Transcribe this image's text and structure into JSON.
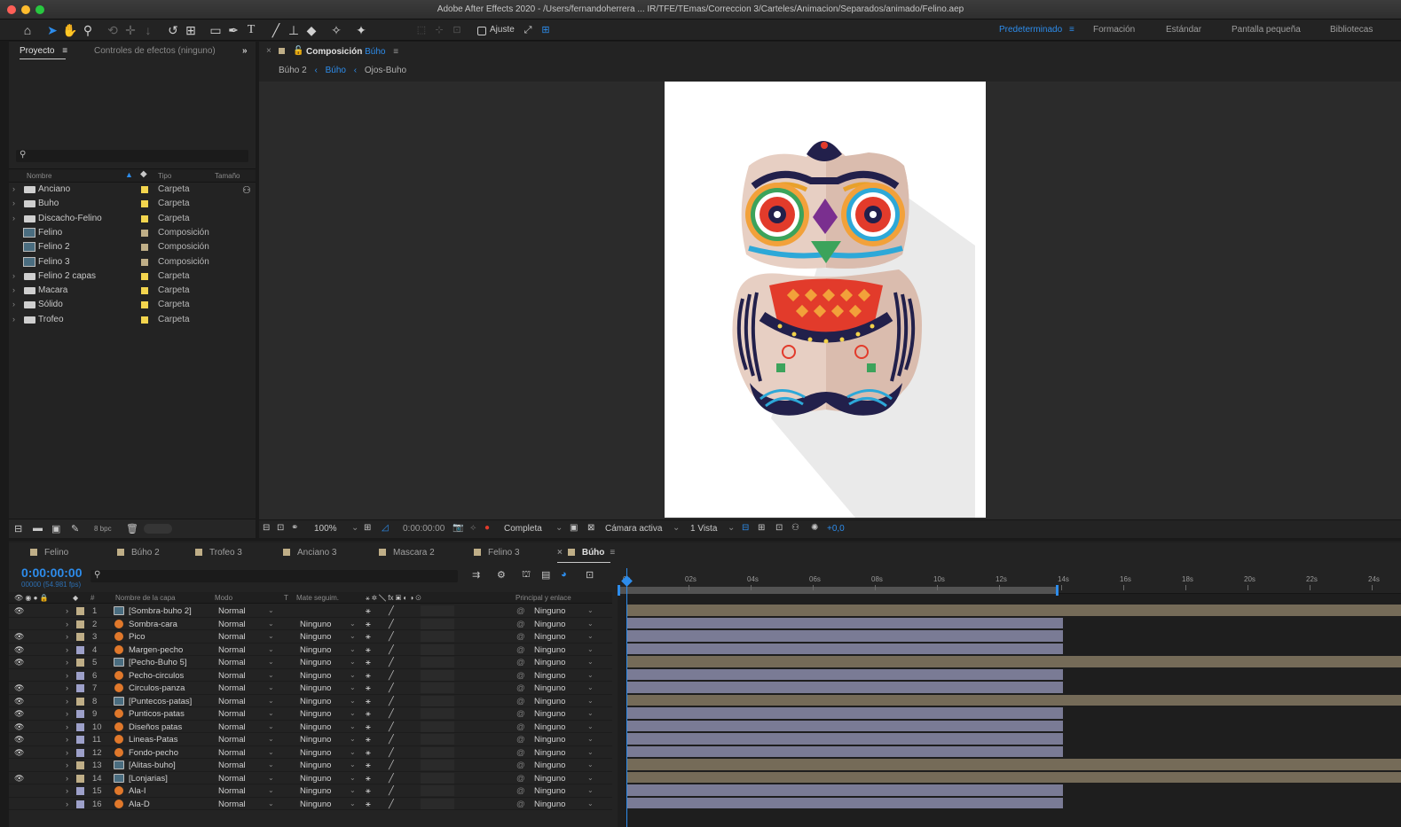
{
  "window": {
    "title": "Adobe After Effects 2020 - /Users/fernandoherrera ... IR/TFE/TEmas/Correccion 3/Carteles/Animacion/Separados/animado/Felino.aep"
  },
  "toolbar": {
    "snap_label": "Ajuste",
    "workspaces": [
      "Predeterminado",
      "Formación",
      "Estándar",
      "Pantalla pequeña",
      "Bibliotecas"
    ],
    "active_workspace_color": "#2d8ceb"
  },
  "project_panel": {
    "tabs": [
      "Proyecto",
      "Controles de efectos (ninguno)"
    ],
    "columns": [
      "Nombre",
      "Tipo",
      "Tamaño"
    ],
    "bpc": "8 bpc",
    "items": [
      {
        "name": "Anciano",
        "type": "Carpeta",
        "kind": "folder",
        "label_color": "#f3d54e"
      },
      {
        "name": "Buho",
        "type": "Carpeta",
        "kind": "folder",
        "label_color": "#f3d54e"
      },
      {
        "name": "Discacho-Felino",
        "type": "Carpeta",
        "kind": "folder",
        "label_color": "#f3d54e"
      },
      {
        "name": "Felino",
        "type": "Composición",
        "kind": "comp",
        "label_color": "#bfae87"
      },
      {
        "name": "Felino 2",
        "type": "Composición",
        "kind": "comp",
        "label_color": "#bfae87"
      },
      {
        "name": "Felino 3",
        "type": "Composición",
        "kind": "comp",
        "label_color": "#bfae87"
      },
      {
        "name": "Felino 2 capas",
        "type": "Carpeta",
        "kind": "folder",
        "label_color": "#f3d54e"
      },
      {
        "name": "Macara",
        "type": "Carpeta",
        "kind": "folder",
        "label_color": "#f3d54e"
      },
      {
        "name": "Sólido",
        "type": "Carpeta",
        "kind": "folder",
        "label_color": "#f3d54e"
      },
      {
        "name": "Trofeo",
        "type": "Carpeta",
        "kind": "folder",
        "label_color": "#f3d54e"
      }
    ]
  },
  "composition_panel": {
    "tab_prefix": "Composición",
    "tab_name": "Búho",
    "breadcrumbs": [
      "Búho 2",
      "Búho",
      "Ojos-Buho"
    ],
    "zoom": "100%",
    "timecode": "0:00:00:00",
    "resolution": "Completa",
    "camera": "Cámara activa",
    "views": "1 Vista",
    "exposure": "+0,0"
  },
  "timeline_panel": {
    "tabs": [
      {
        "label": "Felino",
        "color": "#bfae87"
      },
      {
        "label": "Búho 2",
        "color": "#bfae87"
      },
      {
        "label": "Trofeo 3",
        "color": "#bfae87"
      },
      {
        "label": "Anciano 3",
        "color": "#bfae87"
      },
      {
        "label": "Mascara 2",
        "color": "#bfae87"
      },
      {
        "label": "Felino 3",
        "color": "#bfae87"
      },
      {
        "label": "Búho",
        "color": "#bfae87"
      }
    ],
    "timecode": "0:00:00:00",
    "fps": "00000 (54.981 fps)",
    "columns": {
      "hash": "#",
      "name": "Nombre de la capa",
      "mode": "Modo",
      "t": "T",
      "matte": "Mate seguim.",
      "parent": "Principal y enlace"
    },
    "ruler": [
      "0s",
      "02s",
      "04s",
      "06s",
      "08s",
      "10s",
      "12s",
      "14s",
      "16s",
      "18s",
      "20s",
      "22s",
      "24s"
    ],
    "layers": [
      {
        "num": "1",
        "name": "[Sombra-buho 2]",
        "mode": "Normal",
        "matte": "",
        "parent": "Ninguno",
        "icon": "comp",
        "label": "#bfae87",
        "eye": true,
        "bar": "precomp"
      },
      {
        "num": "2",
        "name": "Sombra-cara",
        "mode": "Normal",
        "matte": "Ninguno",
        "parent": "Ninguno",
        "icon": "shape",
        "label": "#bfae87",
        "eye": false,
        "bar": "layer"
      },
      {
        "num": "3",
        "name": "Pico",
        "mode": "Normal",
        "matte": "Ninguno",
        "parent": "Ninguno",
        "icon": "shape",
        "label": "#bfae87",
        "eye": true,
        "bar": "layer"
      },
      {
        "num": "4",
        "name": "Margen-pecho",
        "mode": "Normal",
        "matte": "Ninguno",
        "parent": "Ninguno",
        "icon": "shape",
        "label": "#9da0c9",
        "eye": true,
        "bar": "layer"
      },
      {
        "num": "5",
        "name": "[Pecho-Buho 5]",
        "mode": "Normal",
        "matte": "Ninguno",
        "parent": "Ninguno",
        "icon": "comp",
        "label": "#bfae87",
        "eye": true,
        "bar": "precomp"
      },
      {
        "num": "6",
        "name": "Pecho-circulos",
        "mode": "Normal",
        "matte": "Ninguno",
        "parent": "Ninguno",
        "icon": "shape",
        "label": "#9da0c9",
        "eye": false,
        "bar": "layer"
      },
      {
        "num": "7",
        "name": "Circulos-panza",
        "mode": "Normal",
        "matte": "Ninguno",
        "parent": "Ninguno",
        "icon": "shape",
        "label": "#9da0c9",
        "eye": true,
        "bar": "layer"
      },
      {
        "num": "8",
        "name": "[Puntecos-patas]",
        "mode": "Normal",
        "matte": "Ninguno",
        "parent": "Ninguno",
        "icon": "comp",
        "label": "#bfae87",
        "eye": true,
        "bar": "precomp"
      },
      {
        "num": "9",
        "name": "Punticos-patas",
        "mode": "Normal",
        "matte": "Ninguno",
        "parent": "Ninguno",
        "icon": "shape",
        "label": "#9da0c9",
        "eye": true,
        "bar": "layer"
      },
      {
        "num": "10",
        "name": "Diseños patas",
        "mode": "Normal",
        "matte": "Ninguno",
        "parent": "Ninguno",
        "icon": "shape",
        "label": "#9da0c9",
        "eye": true,
        "bar": "layer"
      },
      {
        "num": "11",
        "name": "Lineas-Patas",
        "mode": "Normal",
        "matte": "Ninguno",
        "parent": "Ninguno",
        "icon": "shape",
        "label": "#9da0c9",
        "eye": true,
        "bar": "layer"
      },
      {
        "num": "12",
        "name": "Fondo-pecho",
        "mode": "Normal",
        "matte": "Ninguno",
        "parent": "Ninguno",
        "icon": "shape",
        "label": "#9da0c9",
        "eye": true,
        "bar": "layer"
      },
      {
        "num": "13",
        "name": "[Alitas-buho]",
        "mode": "Normal",
        "matte": "Ninguno",
        "parent": "Ninguno",
        "icon": "comp",
        "label": "#bfae87",
        "eye": false,
        "bar": "precomp"
      },
      {
        "num": "14",
        "name": "[Lonjarias]",
        "mode": "Normal",
        "matte": "Ninguno",
        "parent": "Ninguno",
        "icon": "comp",
        "label": "#bfae87",
        "eye": true,
        "bar": "precomp"
      },
      {
        "num": "15",
        "name": "Ala-I",
        "mode": "Normal",
        "matte": "Ninguno",
        "parent": "Ninguno",
        "icon": "shape",
        "label": "#9da0c9",
        "eye": false,
        "bar": "layer"
      },
      {
        "num": "16",
        "name": "Ala-D",
        "mode": "Normal",
        "matte": "Ninguno",
        "parent": "Ninguno",
        "icon": "shape",
        "label": "#9da0c9",
        "eye": false,
        "bar": "layer"
      }
    ]
  },
  "colors": {
    "accent_blue": "#2d8ceb",
    "layer_bar": "#7a7b95",
    "precomp_bar": "#756b58",
    "panel_bg": "#232323"
  }
}
